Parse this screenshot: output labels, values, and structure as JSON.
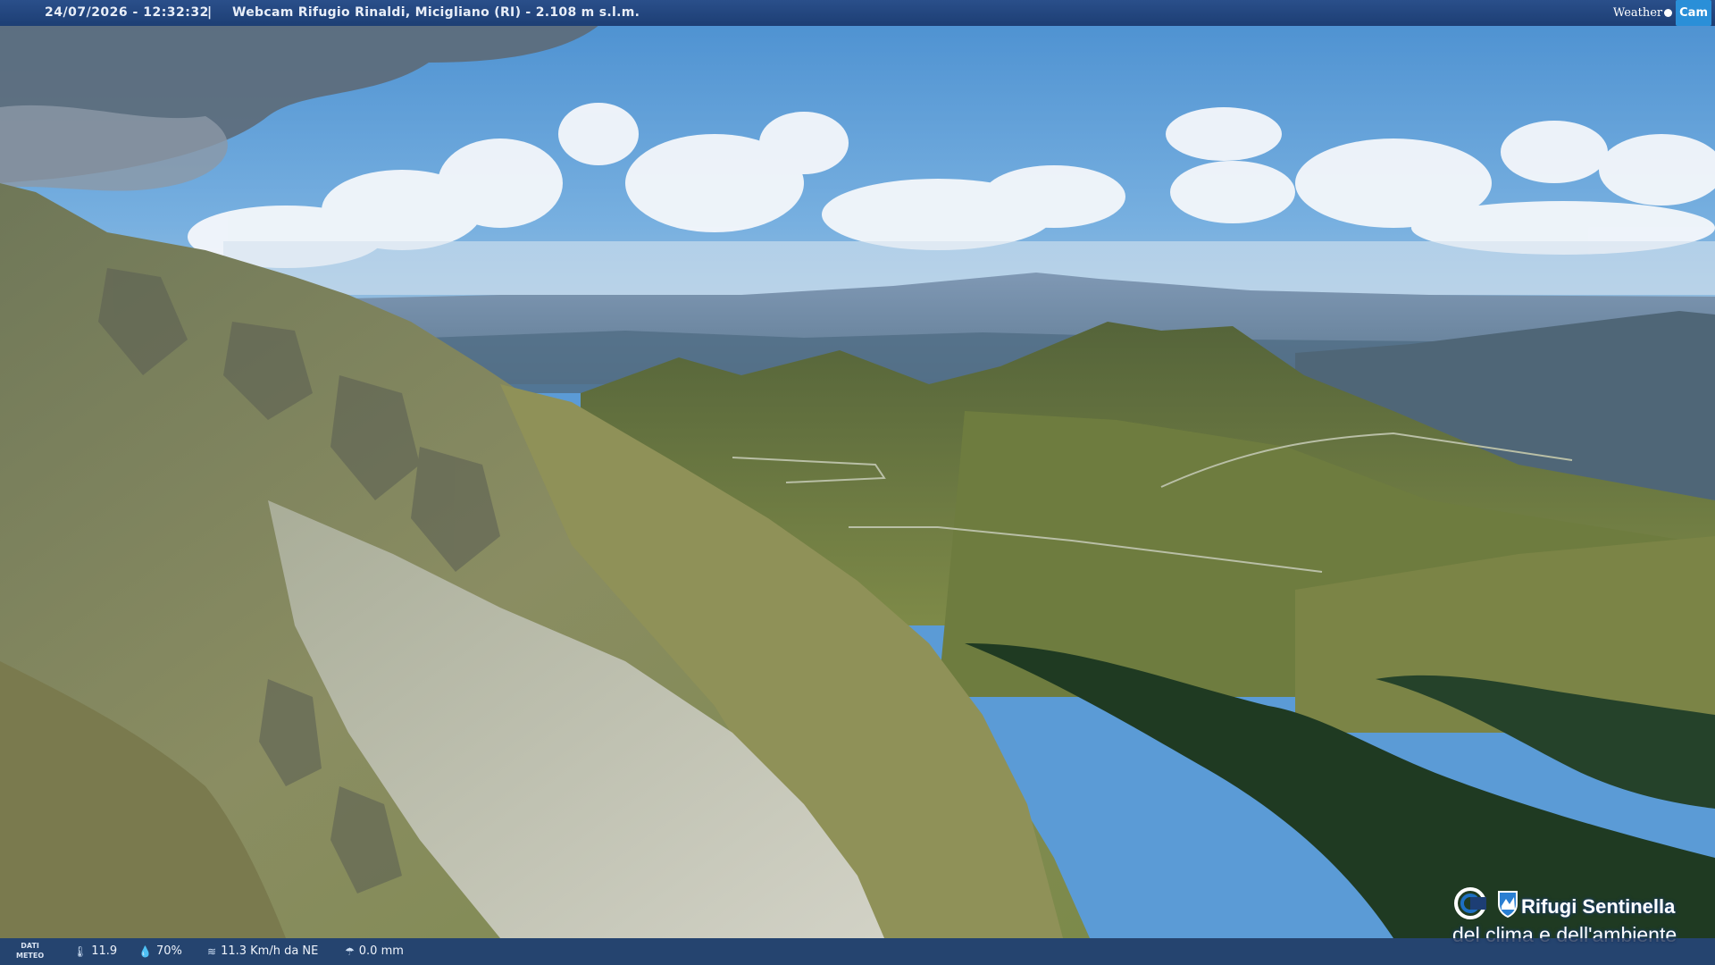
{
  "header": {
    "datetime": "24/07/2026 - 12:32:32",
    "separator": "|",
    "title": "Webcam Rifugio Rinaldi, Micigliano (RI) - 2.108 m s.l.m.",
    "brand_left": "Weather",
    "brand_right": "Cam"
  },
  "weather": {
    "label_line1": "DATI",
    "label_line2": "METEO",
    "temperature": "11.9",
    "humidity": "70%",
    "wind": "11.3 Km/h da NE",
    "rain": "0.0 mm",
    "icons": [
      "thermometer-icon",
      "humidity-icon",
      "wind-icon",
      "rain-icon"
    ]
  },
  "logo": {
    "line1": "Rifugi Sentinella",
    "line2": "del clima e dell'ambiente"
  },
  "colors": {
    "sky": "#5b9bd6",
    "bar": "#1d3e74",
    "grass": "#7a8a45",
    "scree": "#c9cabd",
    "forest": "#1f3a22"
  }
}
